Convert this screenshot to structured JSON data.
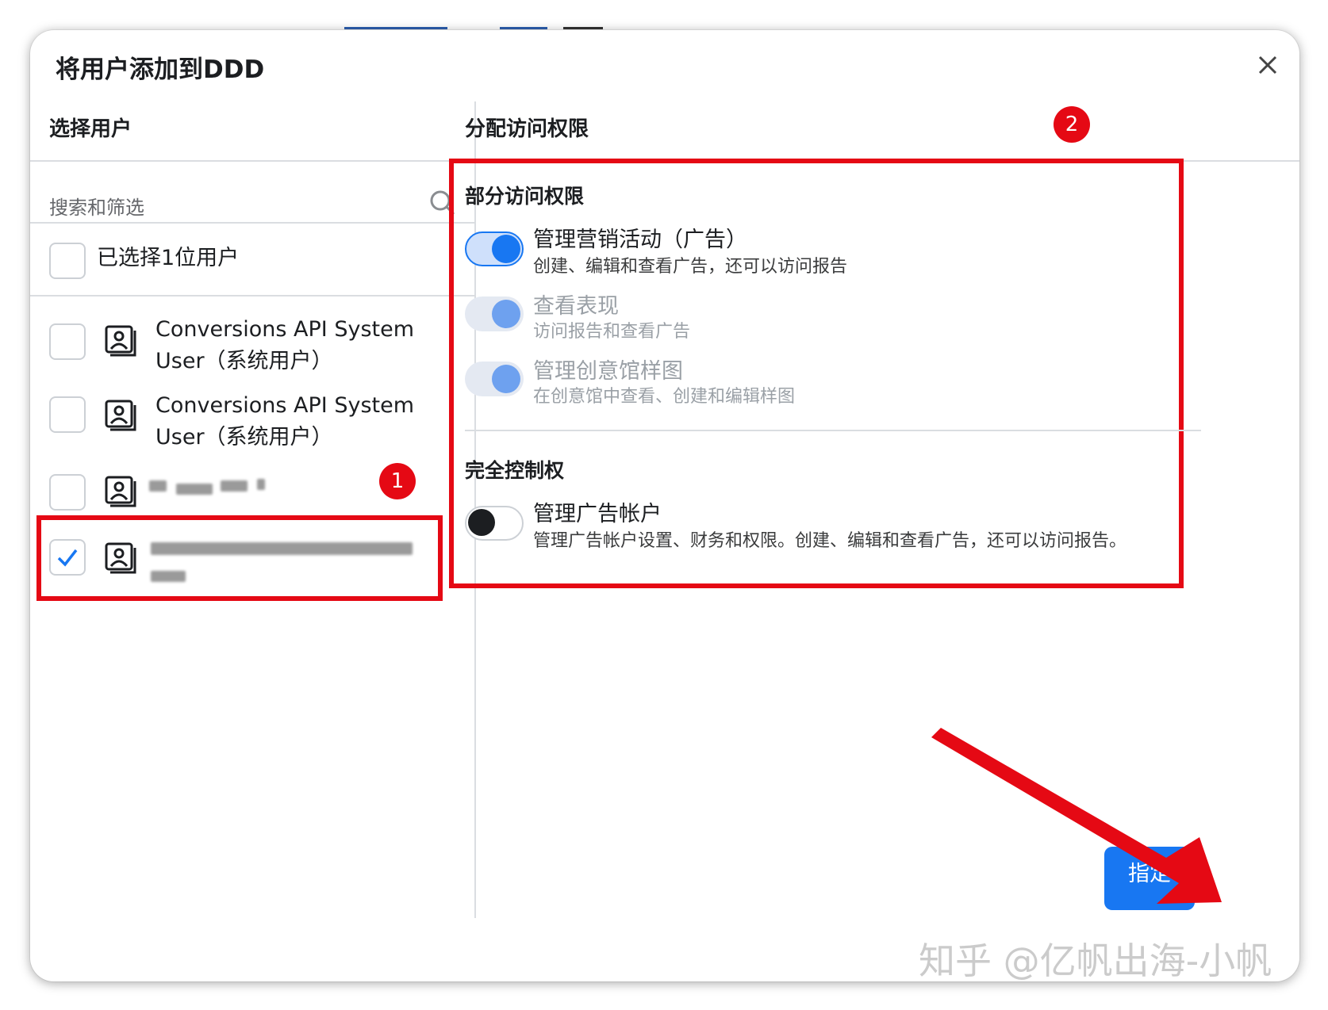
{
  "dialog": {
    "title": "将用户添加到DDD"
  },
  "left_panel": {
    "heading": "选择用户",
    "search_placeholder": "搜索和筛选",
    "select_all_label": "已选择1位用户",
    "users": [
      {
        "name_line1": "Conversions API System",
        "name_line2": "User（系统用户）",
        "checked": false
      },
      {
        "name_line1": "Conversions API System",
        "name_line2": "User（系统用户）",
        "checked": false
      },
      {
        "name_line1": "",
        "name_line2": "",
        "checked": false,
        "redacted": true
      },
      {
        "name_line1": "",
        "name_line2": "",
        "checked": true,
        "redacted": true
      }
    ]
  },
  "right_panel": {
    "heading": "分配访问权限",
    "partial_access": {
      "heading": "部分访问权限",
      "items": [
        {
          "title": "管理营销活动（广告）",
          "desc": "创建、编辑和查看广告，还可以访问报告",
          "on": true,
          "disabled": false
        },
        {
          "title": "查看表现",
          "desc": "访问报告和查看广告",
          "on": true,
          "disabled": true
        },
        {
          "title": "管理创意馆样图",
          "desc": "在创意馆中查看、创建和编辑样图",
          "on": true,
          "disabled": true
        }
      ]
    },
    "full_control": {
      "heading": "完全控制权",
      "items": [
        {
          "title": "管理广告帐户",
          "desc": "管理广告帐户设置、财务和权限。创建、编辑和查看广告，还可以访问报告。",
          "on": false,
          "disabled": false
        }
      ]
    }
  },
  "annotations": {
    "badge_1": "1",
    "badge_2": "2"
  },
  "footer": {
    "assign_button": "指定"
  },
  "watermark": "知乎 @亿帆出海-小帆",
  "colors": {
    "accent": "#1877f2",
    "annotation_red": "#e50914",
    "toggle_track_on": "#d8e4fb",
    "toggle_disabled_knob": "#6ea1ef",
    "divider": "#dadde1"
  },
  "icons": {
    "close": "close-icon",
    "search": "search-icon",
    "user": "user-id-card-icon",
    "check": "checkmark-icon"
  }
}
